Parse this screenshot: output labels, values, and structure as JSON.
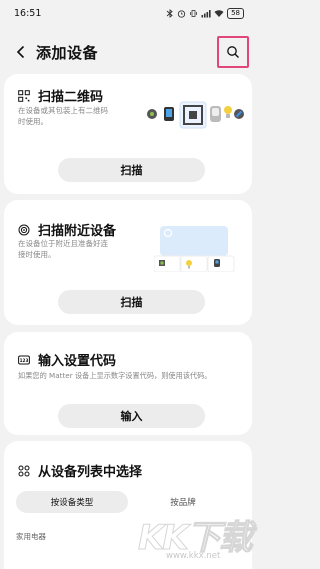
{
  "status_bar": {
    "time": "16:51",
    "icons": [
      "bluetooth-icon",
      "alarm-icon",
      "vibrate-icon",
      "signal-icon",
      "wifi-icon"
    ],
    "battery": "58"
  },
  "header": {
    "title": "添加设备"
  },
  "scan_card": {
    "title": "扫描二维码",
    "desc": "在设备或其包装上有二维码\n时使用。",
    "button": "扫描"
  },
  "nearby_card": {
    "title": "扫描附近设备",
    "desc": "在设备位于附近且准备好连\n接时使用。",
    "button": "扫描"
  },
  "code_card": {
    "title": "输入设置代码",
    "desc": "如果您的 Matter 设备上显示数字设置代码，则使用该代码。",
    "button": "输入"
  },
  "list_card": {
    "title": "从设备列表中选择",
    "tabs": [
      "按设备类型",
      "按品牌"
    ],
    "section": "家用电器"
  },
  "watermark": {
    "text": "KK下载",
    "url": "www.kkx.net"
  },
  "colors": {
    "highlight": "#e0457b",
    "card": "#ffffff",
    "background": "#f2f2f2",
    "button": "#ececec"
  }
}
